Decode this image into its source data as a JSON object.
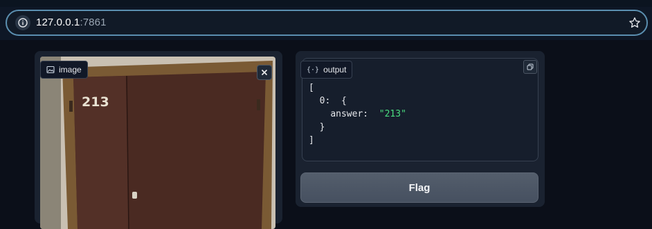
{
  "browser": {
    "url_host": "127.0.0.1",
    "url_port": ":7861"
  },
  "image_component": {
    "label": "image",
    "photo_text": "213"
  },
  "output_component": {
    "label": "output",
    "json_lines": {
      "open_bracket": "[",
      "index_key": "0:",
      "open_brace": "{",
      "answer_key": "answer:",
      "answer_value": "\"213\"",
      "close_brace": "}",
      "close_bracket": "]"
    }
  },
  "flag_button": {
    "label": "Flag"
  },
  "colors": {
    "background": "#0b0f19",
    "panel": "#1a2230",
    "json_string": "#4ade80",
    "url_border": "#5b8fb0"
  }
}
